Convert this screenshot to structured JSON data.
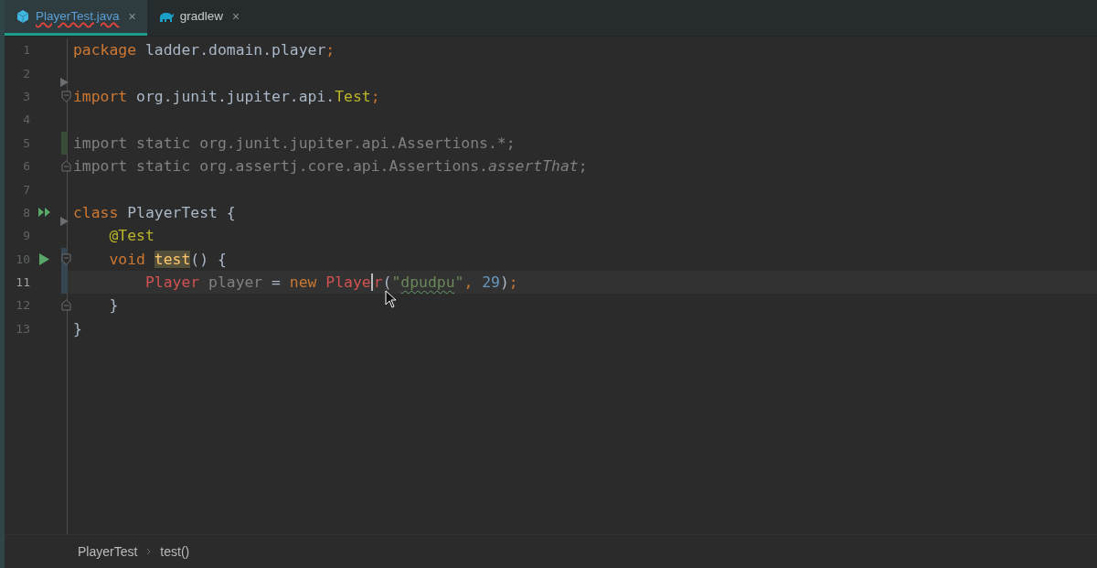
{
  "tabs": [
    {
      "label": "PlayerTest.java",
      "close": "×",
      "selected": true,
      "typo": true
    },
    {
      "label": "gradlew",
      "close": "×",
      "selected": false,
      "typo": false
    }
  ],
  "lines": [
    {
      "number": "1",
      "tokens": [
        {
          "kind": "keyword",
          "text": "package "
        },
        {
          "kind": "plain",
          "text": "ladder.domain.player"
        },
        {
          "kind": "keyword",
          "text": ";"
        }
      ]
    },
    {
      "number": "2"
    },
    {
      "number": "3",
      "fold_start": true,
      "arrow_marker": true,
      "tokens": [
        {
          "kind": "keyword",
          "text": "import "
        },
        {
          "kind": "plain",
          "text": "org.junit.jupiter.api."
        },
        {
          "kind": "type",
          "text": "Test"
        },
        {
          "kind": "keyword",
          "text": ";"
        }
      ]
    },
    {
      "number": "4"
    },
    {
      "number": "5",
      "vcs_added": true,
      "tokens": [
        {
          "kind": "unused",
          "text": "import static org.junit.jupiter.api.Assertions.*;"
        }
      ]
    },
    {
      "number": "6",
      "fold_end": true,
      "tokens": [
        {
          "kind": "unused",
          "text": "import static org.assertj.core.api.Assertions."
        },
        {
          "kind": "unused-italic",
          "text": "assertThat"
        },
        {
          "kind": "unused",
          "text": ";"
        }
      ]
    },
    {
      "number": "7"
    },
    {
      "number": "8",
      "run_all": true,
      "tokens": [
        {
          "kind": "keyword",
          "text": "class "
        },
        {
          "kind": "plain",
          "text": "PlayerTest {"
        }
      ]
    },
    {
      "number": "9",
      "arrow_marker": true,
      "tokens": [
        {
          "kind": "annotation",
          "text": "    @Test"
        }
      ]
    },
    {
      "number": "10",
      "run": true,
      "fold_start": true,
      "vcs_modified": true,
      "tokens": [
        {
          "kind": "keyword",
          "text": "    void "
        },
        {
          "kind": "method-highlight",
          "text": "test"
        },
        {
          "kind": "plain",
          "text": "() {"
        }
      ]
    },
    {
      "number": "11",
      "current": true,
      "vcs_modified": true,
      "tokens": [
        {
          "kind": "error",
          "text": "        Player "
        },
        {
          "kind": "unused",
          "text": "player "
        },
        {
          "kind": "plain",
          "text": "= "
        },
        {
          "kind": "keyword",
          "text": "new "
        },
        {
          "kind": "error",
          "text": "Playe"
        },
        {
          "kind": "error",
          "text": "r",
          "caret": true
        },
        {
          "kind": "plain",
          "text": "("
        },
        {
          "kind": "string",
          "text": "\""
        },
        {
          "kind": "string-typo",
          "text": "dpudpu"
        },
        {
          "kind": "string",
          "text": "\""
        },
        {
          "kind": "keyword",
          "text": ", "
        },
        {
          "kind": "number",
          "text": "29"
        },
        {
          "kind": "plain",
          "text": ")"
        },
        {
          "kind": "keyword",
          "text": ";"
        }
      ]
    },
    {
      "number": "12",
      "fold_end": true,
      "tokens": [
        {
          "kind": "plain",
          "text": "    }"
        }
      ]
    },
    {
      "number": "13",
      "tokens": [
        {
          "kind": "plain",
          "text": "}"
        }
      ]
    }
  ],
  "breadcrumbs": [
    "PlayerTest",
    "test()"
  ]
}
